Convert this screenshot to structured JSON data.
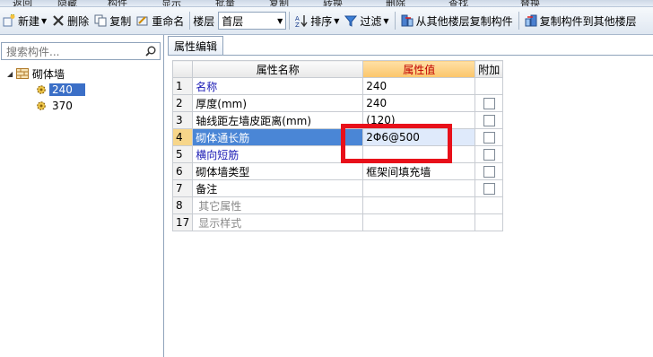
{
  "top_strip": [
    "返回",
    "隐藏",
    "构件",
    "显示",
    "批量",
    "复制",
    "转换",
    "删除",
    "查找",
    "替换"
  ],
  "toolbar": {
    "new_label": "新建",
    "delete_label": "删除",
    "copy_label": "复制",
    "rename_label": "重命名",
    "floor_label": "楼层",
    "floor_value": "首层",
    "sort_label": "排序",
    "filter_label": "过滤",
    "copy_from_floor_label": "从其他楼层复制构件",
    "copy_to_floor_label": "复制构件到其他楼层"
  },
  "search": {
    "placeholder": "搜索构件..."
  },
  "tree": {
    "root_label": "砌体墙",
    "items": [
      {
        "label": "240",
        "selected": true
      },
      {
        "label": "370",
        "selected": false
      }
    ]
  },
  "tab": {
    "label": "属性编辑"
  },
  "grid": {
    "headers": {
      "name": "属性名称",
      "value": "属性值",
      "extra": "附加"
    },
    "rows": [
      {
        "num": "1",
        "name": "名称",
        "value": "240",
        "style": "blue",
        "checkbox": false
      },
      {
        "num": "2",
        "name": "厚度(mm)",
        "value": "240",
        "style": "normal",
        "checkbox": true
      },
      {
        "num": "3",
        "name": "轴线距左墙皮距离(mm)",
        "value": "(120)",
        "style": "normal",
        "checkbox": true
      },
      {
        "num": "4",
        "name": "砌体通长筋",
        "value": "2Φ6@500",
        "style": "highlight",
        "checkbox": true
      },
      {
        "num": "5",
        "name": "横向短筋",
        "value": "",
        "style": "blue",
        "checkbox": true
      },
      {
        "num": "6",
        "name": "砌体墙类型",
        "value": "框架间填充墙",
        "style": "normal",
        "checkbox": true
      },
      {
        "num": "7",
        "name": "备注",
        "value": "",
        "style": "normal",
        "checkbox": true
      },
      {
        "num": "8",
        "name": "其它属性",
        "value": "",
        "style": "group",
        "checkbox": false
      },
      {
        "num": "17",
        "name": "显示样式",
        "value": "",
        "style": "group",
        "checkbox": false
      }
    ]
  },
  "colors": {
    "selection": "#3b6fc7",
    "highlight_row": "#4a86d6",
    "value_header": "#fbc56a",
    "annotation_box": "#e8101a",
    "link_text": "#1a1ab5"
  }
}
